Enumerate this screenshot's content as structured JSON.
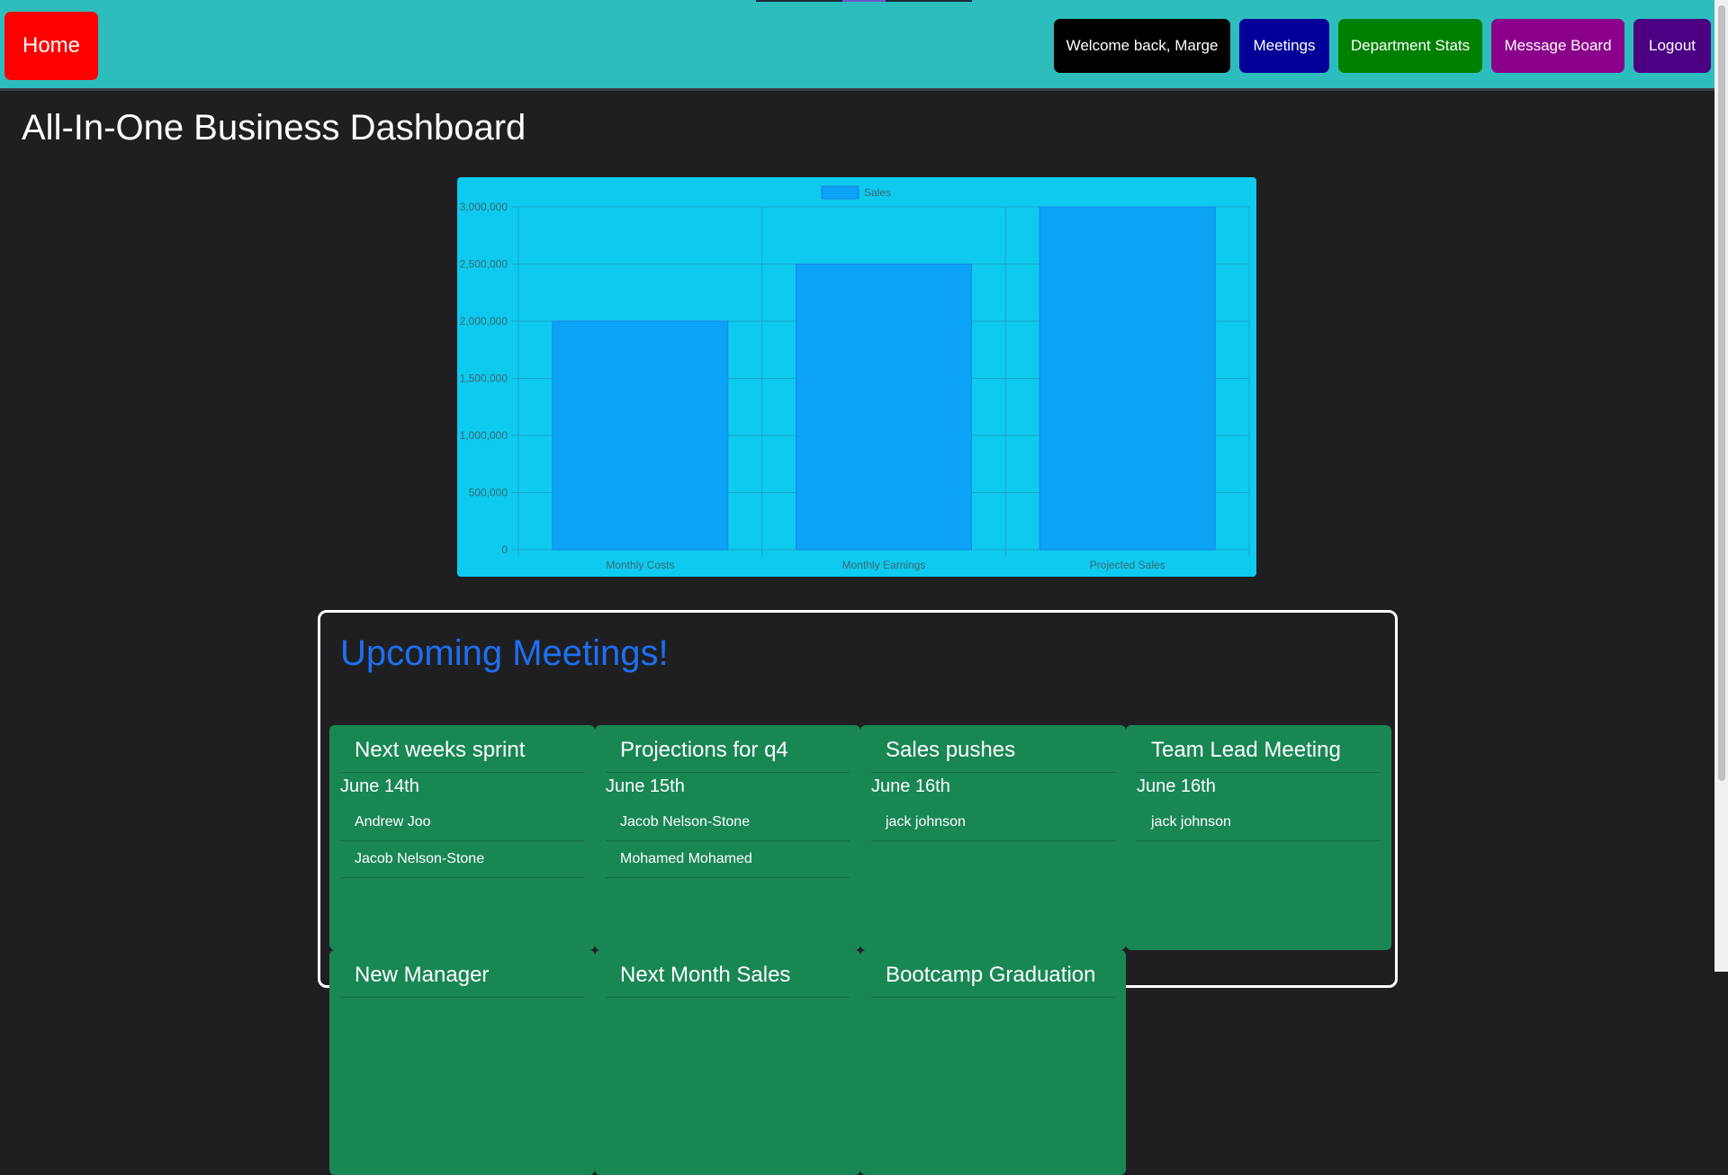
{
  "nav": {
    "home_label": "Home",
    "welcome_label": "Welcome back, Marge",
    "meetings_label": "Meetings",
    "stats_label": "Department Stats",
    "board_label": "Message Board",
    "logout_label": "Logout"
  },
  "page_title": "All-In-One Business Dashboard",
  "chart_data": {
    "type": "bar",
    "categories": [
      "Monthly Costs",
      "Monthly Earnings",
      "Projected Sales"
    ],
    "series": [
      {
        "name": "Sales",
        "values": [
          2000000,
          2500000,
          3000000
        ]
      }
    ],
    "ylim": [
      0,
      3000000
    ],
    "yticks": [
      "0",
      "500,000",
      "1,000,000",
      "1,500,000",
      "2,000,000",
      "2,500,000",
      "3,000,000"
    ],
    "ytick_values": [
      0,
      500000,
      1000000,
      1500000,
      2000000,
      2500000,
      3000000
    ],
    "legend_position": "top",
    "grid": true,
    "colors": {
      "background": "#0ecaee",
      "bar": "#0aa3f5",
      "bar_border": "#1f7fe6",
      "grid": "#1aa7c9",
      "text": "#3a6878"
    }
  },
  "meetings": {
    "title": "Upcoming Meetings!",
    "cards": [
      {
        "title": "Next weeks sprint",
        "date": "June 14th",
        "attendees": [
          "Andrew Joo",
          "Jacob Nelson-Stone"
        ]
      },
      {
        "title": "Projections for q4",
        "date": "June 15th",
        "attendees": [
          "Jacob Nelson-Stone",
          "Mohamed Mohamed"
        ]
      },
      {
        "title": "Sales pushes",
        "date": "June 16th",
        "attendees": [
          "jack johnson"
        ]
      },
      {
        "title": "Team Lead Meeting",
        "date": "June 16th",
        "attendees": [
          "jack johnson"
        ]
      },
      {
        "title": "New Manager",
        "date": "",
        "attendees": []
      },
      {
        "title": "Next Month Sales",
        "date": "",
        "attendees": []
      },
      {
        "title": "Bootcamp Graduation",
        "date": "",
        "attendees": []
      }
    ]
  }
}
